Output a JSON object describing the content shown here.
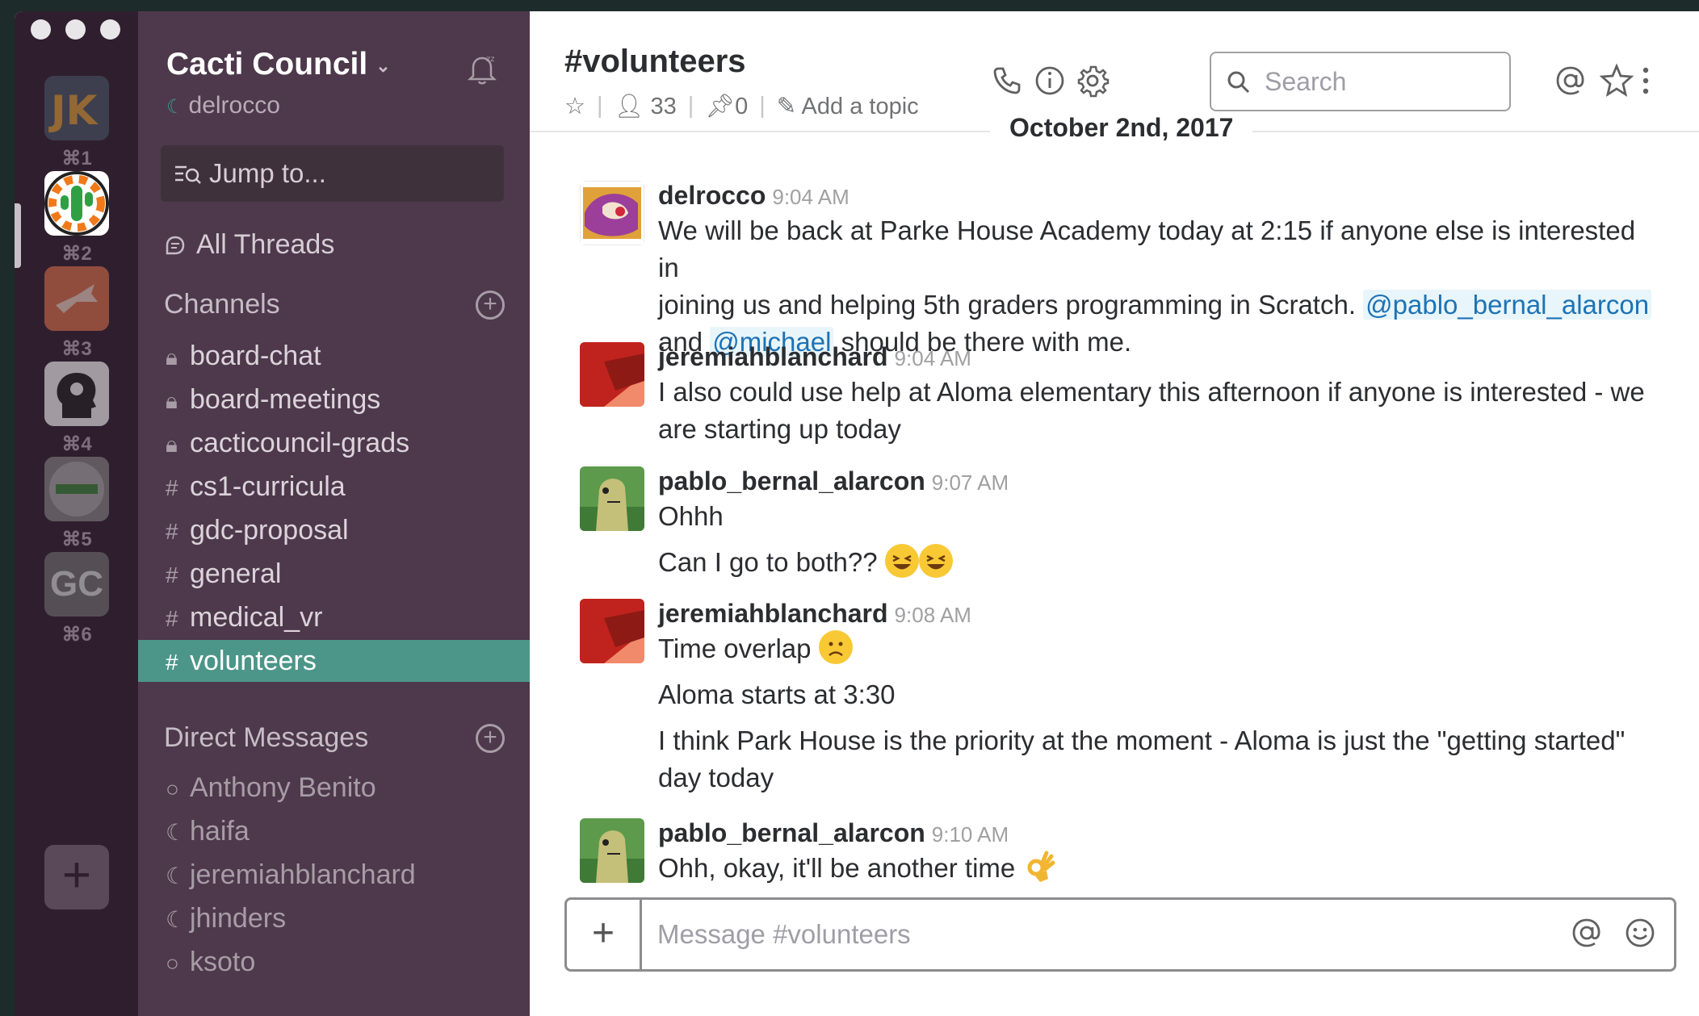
{
  "teams": [
    {
      "shortcut": "⌘1"
    },
    {
      "shortcut": "⌘2"
    },
    {
      "shortcut": "⌘3"
    },
    {
      "shortcut": "⌘4"
    },
    {
      "shortcut": "⌘5"
    },
    {
      "shortcut": "⌘6",
      "initials": "GC"
    }
  ],
  "sidebar": {
    "team_name": "Cacti Council",
    "username": "delrocco",
    "jump_placeholder": "Jump to...",
    "all_threads": "All Threads",
    "channels_header": "Channels",
    "channels": [
      {
        "name": "board-chat",
        "private": true
      },
      {
        "name": "board-meetings",
        "private": true
      },
      {
        "name": "cacticouncil-grads",
        "private": true
      },
      {
        "name": "cs1-curricula",
        "private": false
      },
      {
        "name": "gdc-proposal",
        "private": false
      },
      {
        "name": "general",
        "private": false
      },
      {
        "name": "medical_vr",
        "private": false
      },
      {
        "name": "volunteers",
        "private": false,
        "active": true
      }
    ],
    "dm_header": "Direct Messages",
    "dms": [
      "Anthony Benito",
      "haifa",
      "jeremiahblanchard",
      "jhinders",
      "ksoto"
    ]
  },
  "header": {
    "channel": "#volunteers",
    "members": "33",
    "pins": "0",
    "add_topic": "Add a topic",
    "search_placeholder": "Search"
  },
  "date_divider": "October 2nd, 2017",
  "messages": [
    {
      "user": "delrocco",
      "time": "9:04 AM",
      "lines": [
        "We will be back at Parke House Academy today at 2:15 if anyone else is interested in",
        "joining us and helping 5th graders programming in Scratch. ",
        "@pablo_bernal_alarcon",
        "and ",
        "@michael",
        " should be there with me."
      ]
    },
    {
      "user": "jeremiahblanchard",
      "time": "9:04 AM",
      "text": "I also could use help at Aloma elementary this afternoon if anyone is interested - we are starting up today"
    },
    {
      "user": "pablo_bernal_alarcon",
      "time": "9:07 AM",
      "text": "Ohhh",
      "text2": "Can I go to both??"
    },
    {
      "user": "jeremiahblanchard",
      "time": "9:08 AM",
      "text": "Time overlap",
      "text2": "Aloma starts at 3:30",
      "text3": "I think Park House is the priority at the moment - Aloma is just the \"getting started\" day today"
    },
    {
      "user": "pablo_bernal_alarcon",
      "time": "9:10 AM",
      "text": "Ohh, okay, it'll be another time"
    }
  ],
  "composer": {
    "placeholder": "Message #volunteers"
  }
}
